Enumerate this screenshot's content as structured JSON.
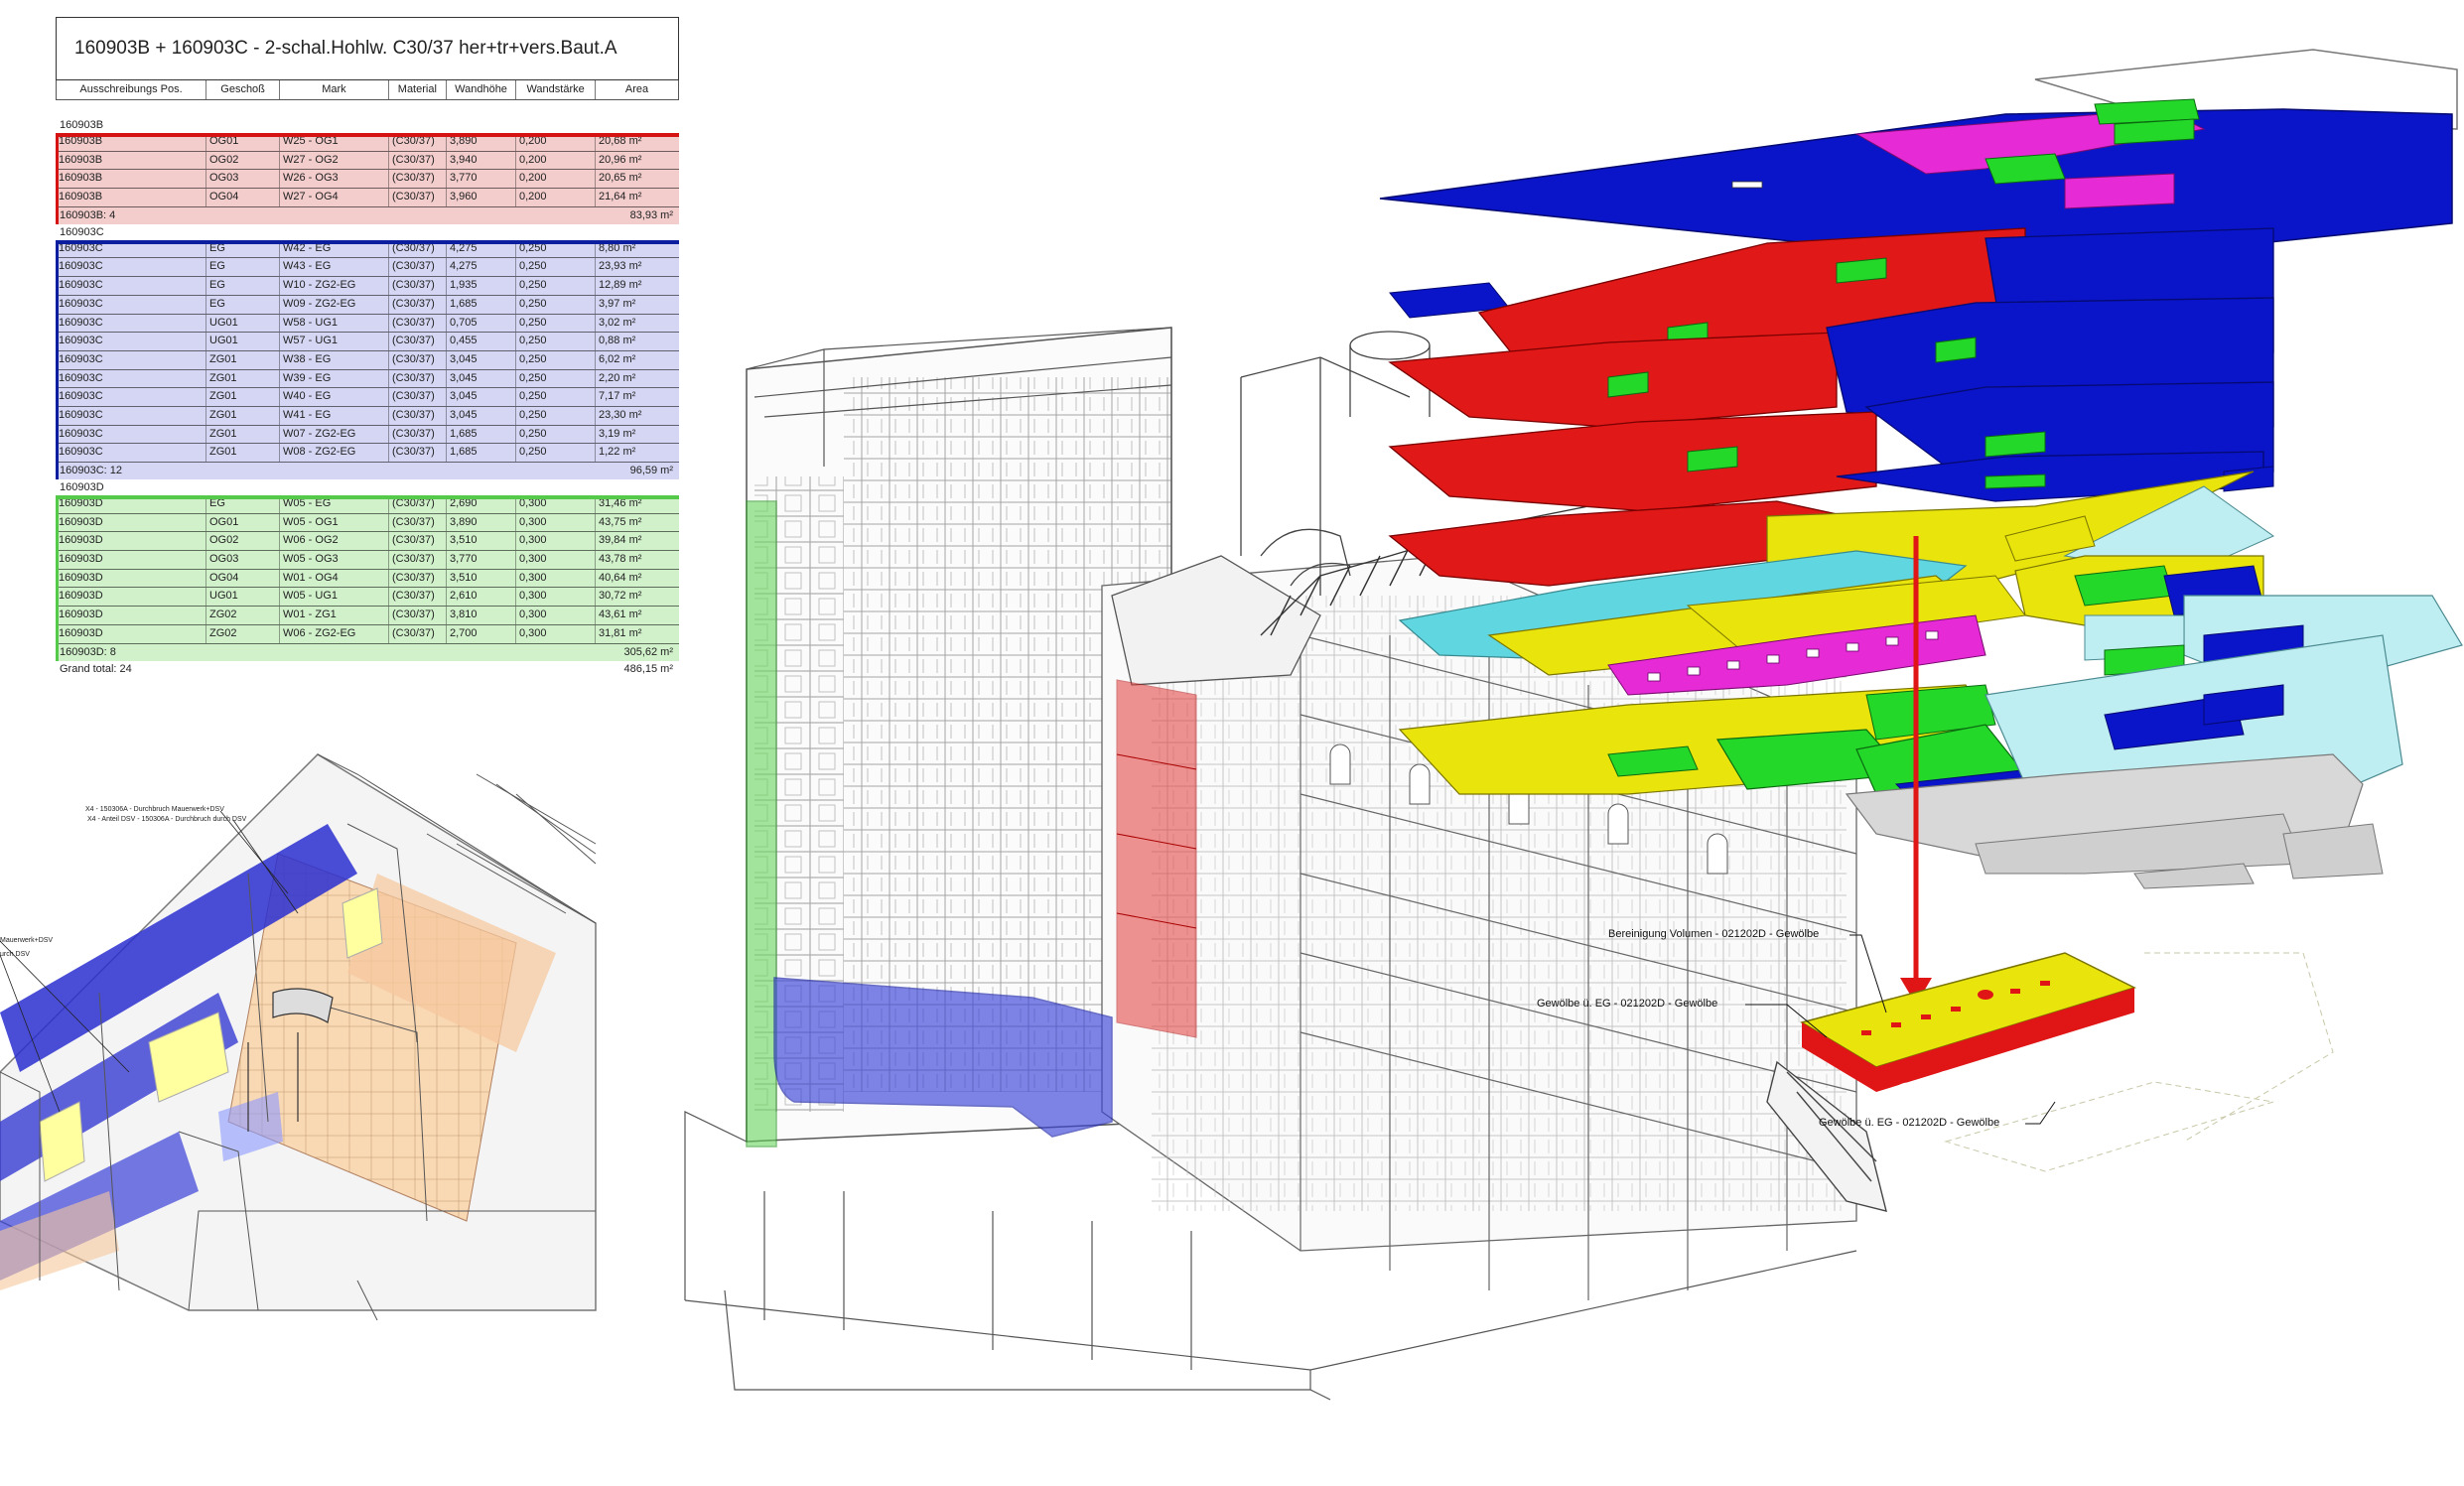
{
  "schedule": {
    "title": "160903B + 160903C - 2-schal.Hohlw. C30/37 her+tr+vers.Baut.A",
    "columns": [
      "Ausschreibungs Pos.",
      "Geschoß",
      "Mark",
      "Material",
      "Wandhöhe",
      "Wandstärke",
      "Area"
    ],
    "groups": [
      {
        "label": "160903B",
        "rows": [
          [
            "160903B",
            "OG01",
            "W25 - OG1",
            "(C30/37)",
            "3,890",
            "0,200",
            "20,68 m²"
          ],
          [
            "160903B",
            "OG02",
            "W27 - OG2",
            "(C30/37)",
            "3,940",
            "0,200",
            "20,96 m²"
          ],
          [
            "160903B",
            "OG03",
            "W26 - OG3",
            "(C30/37)",
            "3,770",
            "0,200",
            "20,65 m²"
          ],
          [
            "160903B",
            "OG04",
            "W27 - OG4",
            "(C30/37)",
            "3,960",
            "0,200",
            "21,64 m²"
          ]
        ],
        "subtotal_label": "160903B: 4",
        "subtotal_area": "83,93 m²"
      },
      {
        "label": "160903C",
        "rows": [
          [
            "160903C",
            "EG",
            "W42 - EG",
            "(C30/37)",
            "4,275",
            "0,250",
            "8,80 m²"
          ],
          [
            "160903C",
            "EG",
            "W43 - EG",
            "(C30/37)",
            "4,275",
            "0,250",
            "23,93 m²"
          ],
          [
            "160903C",
            "EG",
            "W10 - ZG2-EG",
            "(C30/37)",
            "1,935",
            "0,250",
            "12,89 m²"
          ],
          [
            "160903C",
            "EG",
            "W09 - ZG2-EG",
            "(C30/37)",
            "1,685",
            "0,250",
            "3,97 m²"
          ],
          [
            "160903C",
            "UG01",
            "W58 - UG1",
            "(C30/37)",
            "0,705",
            "0,250",
            "3,02 m²"
          ],
          [
            "160903C",
            "UG01",
            "W57 - UG1",
            "(C30/37)",
            "0,455",
            "0,250",
            "0,88 m²"
          ],
          [
            "160903C",
            "ZG01",
            "W38 - EG",
            "(C30/37)",
            "3,045",
            "0,250",
            "6,02 m²"
          ],
          [
            "160903C",
            "ZG01",
            "W39 - EG",
            "(C30/37)",
            "3,045",
            "0,250",
            "2,20 m²"
          ],
          [
            "160903C",
            "ZG01",
            "W40 - EG",
            "(C30/37)",
            "3,045",
            "0,250",
            "7,17 m²"
          ],
          [
            "160903C",
            "ZG01",
            "W41 - EG",
            "(C30/37)",
            "3,045",
            "0,250",
            "23,30 m²"
          ],
          [
            "160903C",
            "ZG01",
            "W07 - ZG2-EG",
            "(C30/37)",
            "1,685",
            "0,250",
            "3,19 m²"
          ],
          [
            "160903C",
            "ZG01",
            "W08 - ZG2-EG",
            "(C30/37)",
            "1,685",
            "0,250",
            "1,22 m²"
          ]
        ],
        "subtotal_label": "160903C: 12",
        "subtotal_area": "96,59 m²"
      },
      {
        "label": "160903D",
        "rows": [
          [
            "160903D",
            "EG",
            "W05 - EG",
            "(C30/37)",
            "2,690",
            "0,300",
            "31,46 m²"
          ],
          [
            "160903D",
            "OG01",
            "W05 - OG1",
            "(C30/37)",
            "3,890",
            "0,300",
            "43,75 m²"
          ],
          [
            "160903D",
            "OG02",
            "W06 - OG2",
            "(C30/37)",
            "3,510",
            "0,300",
            "39,84 m²"
          ],
          [
            "160903D",
            "OG03",
            "W05 - OG3",
            "(C30/37)",
            "3,770",
            "0,300",
            "43,78 m²"
          ],
          [
            "160903D",
            "OG04",
            "W01 - OG4",
            "(C30/37)",
            "3,510",
            "0,300",
            "40,64 m²"
          ],
          [
            "160903D",
            "UG01",
            "W05 - UG1",
            "(C30/37)",
            "2,610",
            "0,300",
            "30,72 m²"
          ],
          [
            "160903D",
            "ZG02",
            "W01 - ZG1",
            "(C30/37)",
            "3,810",
            "0,300",
            "43,61 m²"
          ],
          [
            "160903D",
            "ZG02",
            "W06 - ZG2-EG",
            "(C30/37)",
            "2,700",
            "0,300",
            "31,81 m²"
          ]
        ],
        "subtotal_label": "160903D: 8",
        "subtotal_area": "305,62 m²"
      }
    ],
    "grand_total_label": "Grand total: 24",
    "grand_total_area": "486,15 m²"
  },
  "annotations": {
    "vault_volume": "Bereinigung Volumen - 021202D - Gewölbe",
    "vault_eg_1": "Gewölbe ü. EG - 021202D - Gewölbe",
    "vault_eg_2": "Gewölbe ü. EG - 021202D - Gewölbe",
    "small_1": "X4 - 150306A - Durchbruch Mauerwerk+DSV",
    "small_2": "X4 - Anteil DSV - 150306A - Durchbruch durch DSV",
    "small_3": "Mauerwerk+DSV",
    "small_4": "urch DSV"
  },
  "colors": {
    "red": "#d51313",
    "blue": "#0a14c8",
    "green": "#24d82a",
    "yellow": "#e8e40c",
    "magenta": "#e62ad6",
    "cyan": "#5fd6e0",
    "lightcyan": "#bfeef2",
    "orange": "#f7c99a"
  }
}
